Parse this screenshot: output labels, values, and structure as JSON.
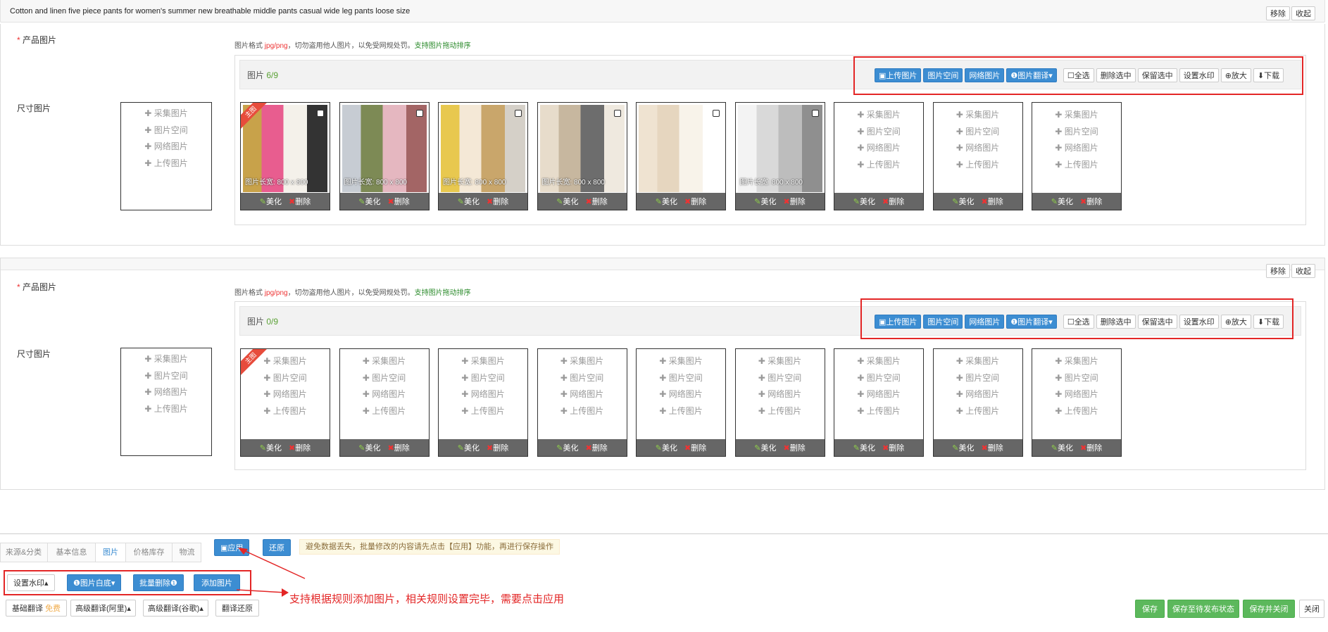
{
  "product_title": "Cotton and linen five piece pants for women's summer new breathable middle pants casual wide leg pants loose size",
  "header_buttons": {
    "remove": "移除",
    "collapse": "收起"
  },
  "labels": {
    "required_star": "*",
    "product_images": "产品图片",
    "size_images": "尺寸图片"
  },
  "hint": {
    "prefix": "图片格式 ",
    "formats": "jpg/png",
    "middle": "，切勿盗用他人图片，以免受网规处罚。",
    "drag": "支持图片拖动排序"
  },
  "toolbar": {
    "upload": "上传图片",
    "space": "图片空间",
    "network": "网络图片",
    "translate": "图片翻译",
    "select_all": "全选",
    "delete_selected": "删除选中",
    "keep_selected": "保留选中",
    "watermark": "设置水印",
    "zoom": "放大",
    "download": "下载"
  },
  "slot_options": [
    "采集图片",
    "图片空间",
    "网络图片",
    "上传图片"
  ],
  "slot_actions": {
    "beautify": "美化",
    "delete": "删除"
  },
  "main_ribbon": "主图",
  "section1": {
    "caption": "图片",
    "count": "6/9",
    "images": [
      {
        "size": "图片长宽: 800 x 800",
        "colors": [
          "#c8a24a",
          "#e85d8f",
          "#f4f1ea",
          "#333"
        ]
      },
      {
        "size": "图片长宽: 800 x 800",
        "colors": [
          "#c7ccd3",
          "#7d8a55",
          "#e5b7c0",
          "#a36565"
        ]
      },
      {
        "size": "图片长宽: 800 x 800",
        "colors": [
          "#e8c84f",
          "#f4e8d6",
          "#c9a66b",
          "#d5d0c8"
        ]
      },
      {
        "size": "图片长宽: 800 x 800",
        "colors": [
          "#e7dccb",
          "#c7b79f",
          "#6d6d6d",
          "#efe9df"
        ]
      },
      {
        "size": "",
        "colors": [
          "#efe3d1",
          "#e6d6bf",
          "#f8f3ea",
          "#ffffff"
        ]
      },
      {
        "size": "图片长宽: 800 x 800",
        "colors": [
          "#f3f3f3",
          "#d9d9d9",
          "#bdbdbd",
          "#8f8f8f"
        ]
      }
    ]
  },
  "section2": {
    "caption": "图片",
    "count": "0/9"
  },
  "tabs": [
    "来源&分类",
    "基本信息",
    "图片",
    "价格库存",
    "物流"
  ],
  "apply_button": "应用",
  "restore_button": "还原",
  "notice": "避免数据丢失，批量修改的内容请先点击【应用】功能，再进行保存操作",
  "batch": {
    "watermark": "设置水印",
    "white_bg": "图片白底",
    "batch_delete": "批量删除",
    "add_image": "添加图片"
  },
  "annotation": "支持根据规则添加图片，相关规则设置完毕，需要点击应用",
  "translate_bar": {
    "basic": "基础翻译",
    "free": "免费",
    "ali": "高级翻译(阿里)",
    "google": "高级翻译(谷歌)",
    "revert": "翻译还原"
  },
  "footer": {
    "save": "保存",
    "save_pending": "保存至待发布状态",
    "save_close": "保存并关闭",
    "close": "关闭"
  },
  "colors": {
    "accent": "#3c8dd2",
    "green": "#5cb85c",
    "red": "#e32626"
  }
}
